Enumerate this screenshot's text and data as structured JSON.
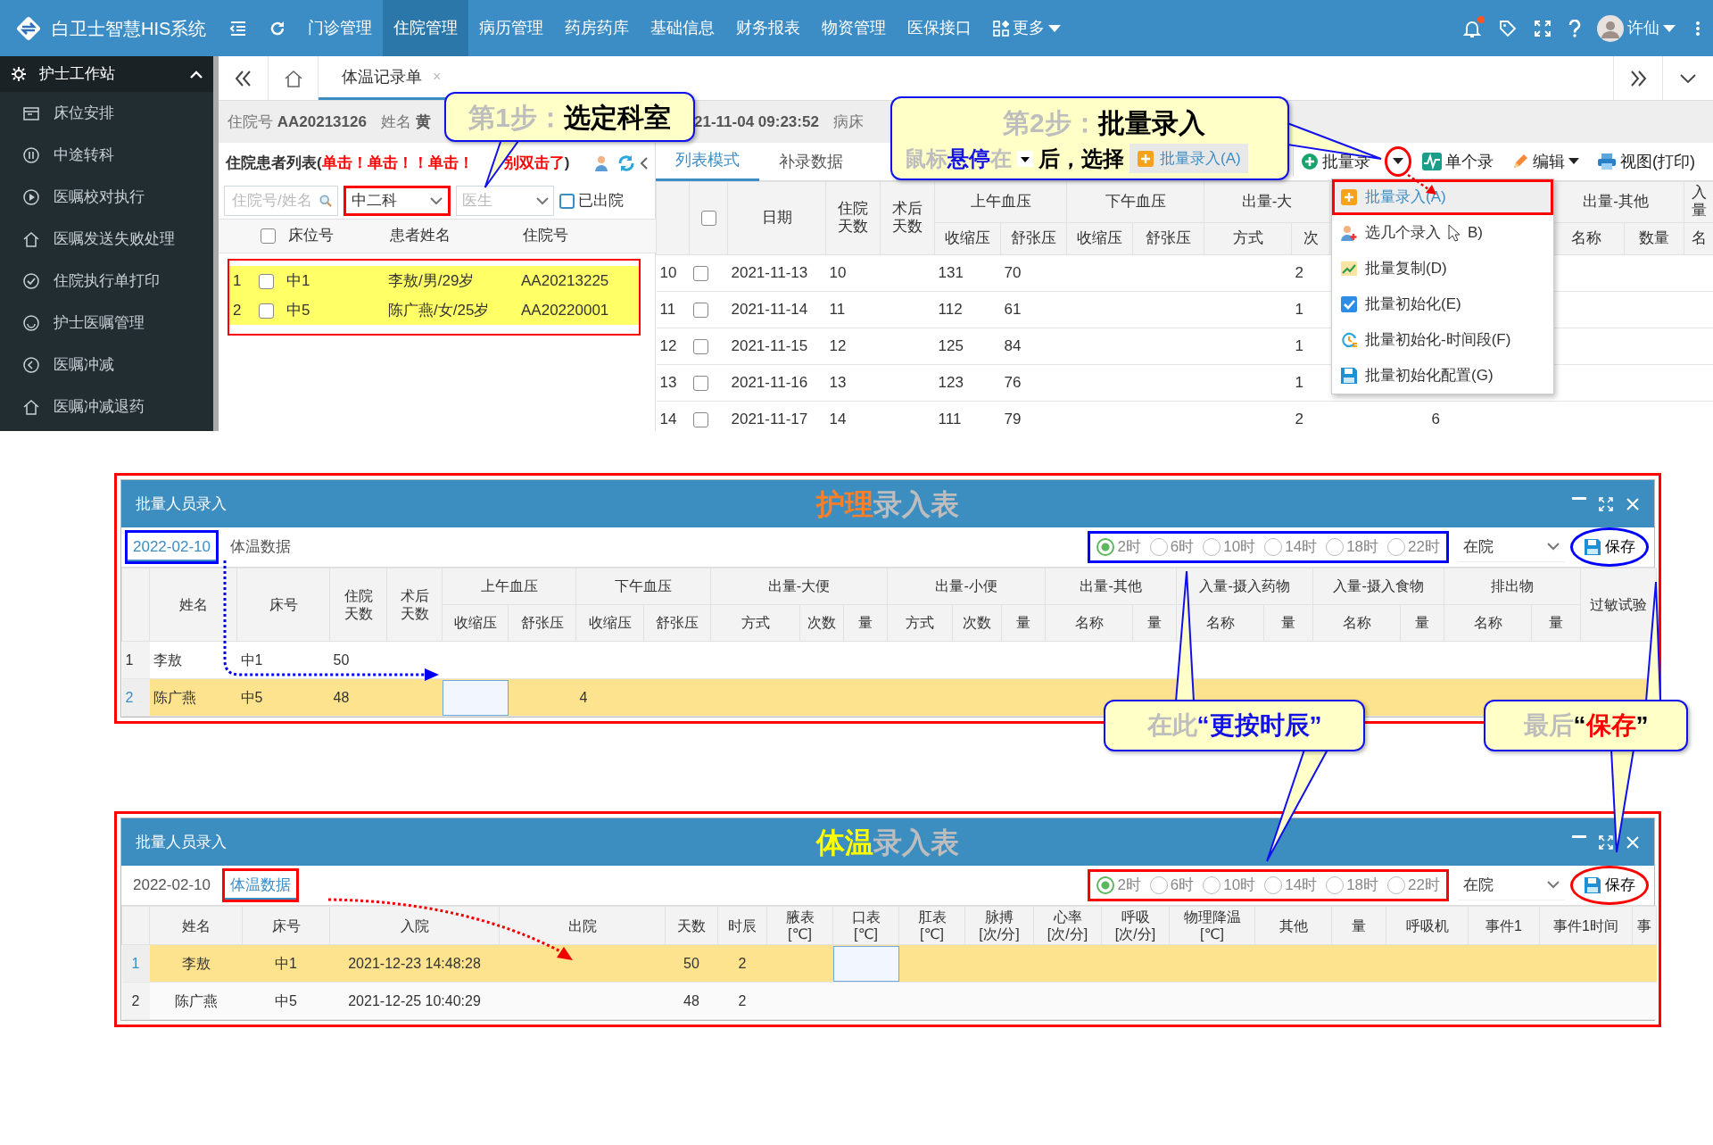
{
  "navbar": {
    "brand": "白卫士智慧HIS系统",
    "has_notification": true,
    "more": "更多",
    "user": "许仙",
    "menu": [
      {
        "label": "门诊管理",
        "selected": false
      },
      {
        "label": "住院管理",
        "selected": true
      },
      {
        "label": "病历管理",
        "selected": false
      },
      {
        "label": "药房药库",
        "selected": false
      },
      {
        "label": "基础信息",
        "selected": false
      },
      {
        "label": "财务报表",
        "selected": false
      },
      {
        "label": "物资管理",
        "selected": false
      },
      {
        "label": "医保接口",
        "selected": false
      }
    ]
  },
  "sidebar": {
    "title": "护士工作站",
    "expanded": true,
    "items": [
      "床位安排",
      "中途转科",
      "医嘱校对执行",
      "医嘱发送失败处理",
      "住院执行单打印",
      "护士医嘱管理",
      "医嘱冲减",
      "医嘱冲减退药"
    ]
  },
  "tabs": [
    {
      "label": "体温记录单",
      "selected": true,
      "close": "×"
    }
  ],
  "patient_info": [
    {
      "label": "住院号",
      "value": "AA20213126"
    },
    {
      "label": "姓名",
      "value": "黄"
    }
  ],
  "patient_info_right": [
    {
      "value": "21-11-04 09:23:52"
    },
    {
      "label": "病床"
    }
  ],
  "patient_list": {
    "title": "住院患者列表(",
    "warnings": [
      "单击！单击！！单击！",
      "别双击了"
    ],
    "title_end": ")",
    "search": {
      "placeholder": "住院号/姓名"
    },
    "department": "中二科",
    "doctor": {
      "placeholder": "医生"
    },
    "discharged": {
      "label": "已出院",
      "checked": false
    },
    "select_all": {
      "checked": false
    },
    "columns": [
      "床位号",
      "患者姓名",
      "住院号"
    ],
    "rows": [
      {
        "index": "1",
        "checked": false,
        "highlighted": true,
        "bed": "中1",
        "name": "李敖/男/29岁",
        "id": "AA20213225"
      },
      {
        "index": "2",
        "checked": false,
        "highlighted": true,
        "bed": "中5",
        "name": "陈广燕/女/25岁",
        "id": "AA20220001"
      }
    ]
  },
  "record": {
    "tabs": [
      {
        "label": "列表模式",
        "selected": true
      },
      {
        "label": "补录数据",
        "selected": false
      }
    ],
    "toolbar": [
      {
        "label": "批量录",
        "kind": "split"
      },
      {
        "label": "单个录",
        "kind": "plain"
      },
      {
        "label": "编辑",
        "kind": "dropdown"
      },
      {
        "label": "视图(打印)",
        "kind": "print"
      }
    ],
    "menu": [
      {
        "label": "批量录入(A)",
        "selected": true
      },
      {
        "label": "选几个录入",
        "suffix": "B)",
        "selected": false
      },
      {
        "label": "批量复制(D)",
        "selected": false
      },
      {
        "label": "批量初始化(E)",
        "selected": false
      },
      {
        "label": "批量初始化-时间段(F)",
        "selected": false
      },
      {
        "label": "批量初始化配置(G)",
        "selected": false
      }
    ],
    "select_all": {
      "checked": false
    },
    "columns": [
      {
        "label": "日期"
      },
      {
        "label": "住院天数"
      },
      {
        "label": "术后天数"
      },
      {
        "label": "上午血压",
        "cols": [
          {
            "label": "收缩压"
          },
          {
            "label": "舒张压"
          }
        ]
      },
      {
        "label": "下午血压",
        "cols": [
          {
            "label": "收缩压"
          },
          {
            "label": "舒张压"
          }
        ]
      },
      {
        "label": "出量-大",
        "cols": [
          {
            "label": "方式"
          },
          {
            "label": "次"
          }
        ]
      },
      {
        "label": "出量-其他",
        "cols": [
          {
            "label": "名称"
          },
          {
            "label": "数量"
          }
        ]
      },
      {
        "label": "入量",
        "cols": [
          {
            "label": "名"
          }
        ]
      }
    ],
    "rows": [
      {
        "index": "10",
        "checked": false,
        "cells": [
          "2021-11-13",
          "10",
          null,
          [
            "131",
            "70"
          ],
          null,
          [
            null,
            "2"
          ]
        ]
      },
      {
        "index": "11",
        "checked": false,
        "cells": [
          "2021-11-14",
          "11",
          null,
          [
            "112",
            "61"
          ],
          null,
          [
            null,
            "1"
          ]
        ]
      },
      {
        "index": "12",
        "checked": false,
        "cells": [
          "2021-11-15",
          "12",
          null,
          [
            "125",
            "84"
          ],
          null,
          [
            null,
            "1"
          ]
        ]
      },
      {
        "index": "13",
        "checked": false,
        "cells": [
          "2021-11-16",
          "13",
          null,
          [
            "123",
            "76"
          ],
          null,
          [
            null,
            "1"
          ]
        ]
      },
      {
        "index": "14",
        "checked": false,
        "cells": [
          "2021-11-17",
          "14",
          null,
          [
            "111",
            "79"
          ],
          null,
          [
            null,
            "2"
          ]
        ],
        "column_13": "6"
      }
    ]
  },
  "dialogs": [
    {
      "title": "批量人员录入",
      "kind": "nursing",
      "title_parts": [
        {
          "text": "护理",
          "color": "#ff7f27"
        },
        {
          "text": "录入表",
          "color": "#bdbdbd"
        }
      ],
      "color": "#0000ff",
      "tabs": [
        {
          "label": "2022-02-10",
          "selected": true
        },
        {
          "label": "体温数据",
          "selected": false
        }
      ],
      "radios": [
        {
          "label": "2时",
          "selected": true
        },
        {
          "label": "6时",
          "selected": false
        },
        {
          "label": "10时",
          "selected": false
        },
        {
          "label": "14时",
          "selected": false
        },
        {
          "label": "18时",
          "selected": false
        },
        {
          "label": "22时",
          "selected": false
        }
      ],
      "status": "在院",
      "save": "保存",
      "columns": [
        {
          "label": "姓名"
        },
        {
          "label": "床号"
        },
        {
          "label": "住院天数"
        },
        {
          "label": "术后天数"
        },
        {
          "label": "上午血压",
          "cols": [
            {
              "label": "收缩压"
            },
            {
              "label": "舒张压"
            }
          ]
        },
        {
          "label": "下午血压",
          "cols": [
            {
              "label": "收缩压"
            },
            {
              "label": "舒张压"
            }
          ]
        },
        {
          "label": "出量-大便",
          "cols": [
            {
              "label": "方式"
            },
            {
              "label": "次数"
            },
            {
              "label": "量"
            }
          ]
        },
        {
          "label": "出量-小便",
          "cols": [
            {
              "label": "方式"
            },
            {
              "label": "次数"
            },
            {
              "label": "量"
            }
          ]
        },
        {
          "label": "出量-其他",
          "cols": [
            {
              "label": "名称"
            },
            {
              "label": "量"
            }
          ]
        },
        {
          "label": "入量-摄入药物",
          "cols": [
            {
              "label": "名称"
            },
            {
              "label": "量"
            }
          ]
        },
        {
          "label": "入量-摄入食物",
          "cols": [
            {
              "label": "名称"
            },
            {
              "label": "量"
            }
          ]
        },
        {
          "label": "排出物",
          "cols": [
            {
              "label": "名称"
            },
            {
              "label": "量"
            }
          ]
        },
        {
          "label": "过敏试验"
        }
      ],
      "rows": [
        {
          "index": "1",
          "selected": false,
          "cells": [
            "李敖",
            "中1",
            "50"
          ]
        },
        {
          "index": "2",
          "selected": true,
          "cells": [
            "陈广燕",
            "中5",
            "48",
            null,
            [
              {
                "editing": true
              }
            ],
            [
              "4"
            ]
          ]
        }
      ]
    },
    {
      "title": "批量人员录入",
      "kind": "vitals",
      "title_parts": [
        {
          "text": "体温",
          "color": "#ffff00"
        },
        {
          "text": "录入表",
          "color": "#bdbdbd"
        }
      ],
      "color": "#ff0000",
      "tabs": [
        {
          "label": "2022-02-10",
          "selected": false
        },
        {
          "label": "体温数据",
          "selected": true
        }
      ],
      "radios": [
        {
          "label": "2时",
          "selected": true
        },
        {
          "label": "6时",
          "selected": false
        },
        {
          "label": "10时",
          "selected": false
        },
        {
          "label": "14时",
          "selected": false
        },
        {
          "label": "18时",
          "selected": false
        },
        {
          "label": "22时",
          "selected": false
        }
      ],
      "status": "在院",
      "save": "保存",
      "columns": [
        {
          "label": "姓名"
        },
        {
          "label": "床号"
        },
        {
          "label": "入院"
        },
        {
          "label": "出院"
        },
        {
          "label": "天数"
        },
        {
          "label": "时辰"
        },
        {
          "label": "腋表\n[℃]"
        },
        {
          "label": "口表\n[℃]"
        },
        {
          "label": "肛表\n[℃]"
        },
        {
          "label": "脉搏\n[次/分]"
        },
        {
          "label": "心率\n[次/分]"
        },
        {
          "label": "呼吸\n[次/分]"
        },
        {
          "label": "物理降温\n[℃]"
        },
        {
          "label": "其他"
        },
        {
          "label": "量"
        },
        {
          "label": "呼吸机"
        },
        {
          "label": "事件1"
        },
        {
          "label": "事件1时间"
        },
        {
          "label": "事"
        }
      ],
      "rows": [
        {
          "index": "1",
          "selected": true,
          "cells": [
            "李敖",
            "中1",
            "2021-12-23 14:48:28",
            null,
            "50",
            "2",
            null,
            {
              "editing": true
            }
          ]
        },
        {
          "index": "2",
          "selected": false,
          "cells": [
            "陈广燕",
            "中5",
            "2021-12-25 10:40:29",
            null,
            "48",
            "2"
          ]
        }
      ]
    }
  ],
  "callouts": [
    {
      "lines": [
        [
          {
            "kind": "text",
            "parts": [
              {
                "text": "第1步：",
                "color": "#bdbdbd"
              },
              {
                "text": "选定科室",
                "color": "#000000"
              }
            ]
          }
        ]
      ]
    },
    {
      "lines": [
        [
          {
            "kind": "text",
            "parts": [
              {
                "text": "第2步：",
                "color": "#bdbdbd"
              },
              {
                "text": "批量录入",
                "color": "#000000"
              }
            ]
          }
        ],
        [
          {
            "kind": "text",
            "parts": [
              {
                "text": "鼠标",
                "color": "#bdbdbd"
              },
              {
                "text": "悬停",
                "color": "#1212e6"
              },
              {
                "text": "在",
                "color": "#bdbdbd"
              }
            ]
          },
          {
            "kind": "caret"
          },
          {
            "kind": "text",
            "parts": [
              {
                "text": "后，选择",
                "color": "#000000"
              }
            ]
          },
          {
            "kind": "chip",
            "text": "批量录入(A)"
          }
        ]
      ]
    },
    {
      "lines": [
        [
          {
            "kind": "text",
            "parts": [
              {
                "text": "在此",
                "color": "#bdbdbd"
              },
              {
                "text": "“更按时辰”",
                "color": "#1212e6"
              }
            ]
          }
        ]
      ]
    },
    {
      "lines": [
        [
          {
            "kind": "text",
            "parts": [
              {
                "text": "最后",
                "color": "#bdbdbd"
              },
              {
                "text": "“",
                "color": "#000000"
              },
              {
                "text": "保存",
                "color": "#ff0000"
              },
              {
                "text": "”",
                "color": "#000000"
              }
            ]
          }
        ]
      ]
    }
  ]
}
